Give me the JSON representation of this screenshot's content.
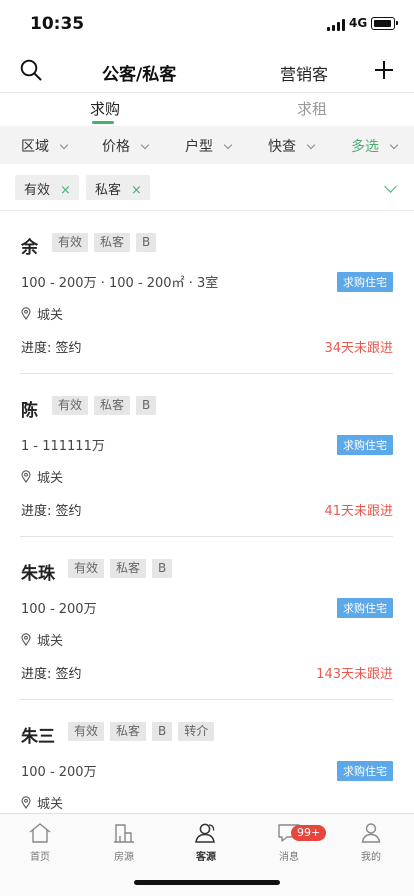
{
  "status_bar": {
    "time": "10:35",
    "network": "4G"
  },
  "nav": {
    "title": "公客/私客",
    "marketing_link": "营销客"
  },
  "tabs": [
    {
      "label": "求购",
      "active": true
    },
    {
      "label": "求租",
      "active": false
    }
  ],
  "filters": [
    {
      "label": "区域"
    },
    {
      "label": "价格"
    },
    {
      "label": "户型"
    },
    {
      "label": "快查"
    },
    {
      "label": "多选"
    }
  ],
  "active_chips": [
    {
      "label": "有效"
    },
    {
      "label": "私客"
    }
  ],
  "chip_remove_glyph": "×",
  "customers": [
    {
      "name": "余",
      "tags": [
        "有效",
        "私客",
        "B"
      ],
      "detail": "100 - 200万 · 100 - 200㎡ · 3室",
      "type": "求购住宅",
      "location": "城关",
      "progress": "进度: 签约",
      "followup": "34天未跟进"
    },
    {
      "name": "陈",
      "tags": [
        "有效",
        "私客",
        "B"
      ],
      "detail": "1 - 111111万",
      "type": "求购住宅",
      "location": "城关",
      "progress": "进度: 签约",
      "followup": "41天未跟进"
    },
    {
      "name": "朱珠",
      "tags": [
        "有效",
        "私客",
        "B"
      ],
      "detail": "100 - 200万",
      "type": "求购住宅",
      "location": "城关",
      "progress": "进度: 签约",
      "followup": "143天未跟进"
    },
    {
      "name": "朱三",
      "tags": [
        "有效",
        "私客",
        "B",
        "转介"
      ],
      "detail": "100 - 200万",
      "type": "求购住宅",
      "location": "城关",
      "progress": "",
      "followup": ""
    }
  ],
  "tabbar": [
    {
      "label": "首页",
      "icon": "home-icon",
      "active": false
    },
    {
      "label": "房源",
      "icon": "building-icon",
      "active": false
    },
    {
      "label": "客源",
      "icon": "customers-icon",
      "active": true
    },
    {
      "label": "消息",
      "icon": "message-icon",
      "active": false,
      "badge": "99+"
    },
    {
      "label": "我的",
      "icon": "profile-icon",
      "active": false
    }
  ],
  "colors": {
    "accent_green": "#4caf72",
    "badge_blue": "#5ca8e8",
    "alert_red": "#e85a4f"
  }
}
